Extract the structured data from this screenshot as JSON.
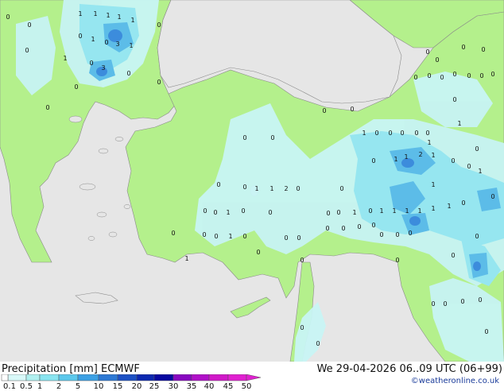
{
  "footer": {
    "title": "Precipitation [mm]  ECMWF",
    "datetime": "We 29-04-2026 06..09 UTC (06+99)",
    "credit": "©weatheronline.co.uk"
  },
  "legend": {
    "ticks": [
      "0.1",
      "0.5",
      "1",
      "2",
      "5",
      "10",
      "15",
      "20",
      "25",
      "30",
      "35",
      "40",
      "45",
      "50"
    ],
    "colors": [
      "#ffffff",
      "#d8f8f8",
      "#b0f0f0",
      "#88e4f0",
      "#5cc8ec",
      "#3ca0e4",
      "#2c78d4",
      "#1c50c4",
      "#0c28b0",
      "#0808a0",
      "#8808c0",
      "#b010c8",
      "#d018c8",
      "#e020d0"
    ]
  },
  "map_colors": {
    "sea": "#e6e6e6",
    "land": "#b4f08c",
    "precip_light": "#c8f4f4",
    "precip_moderate": "#96e6f0",
    "precip_heavy": "#5cbce8",
    "precip_intense": "#3c8cdc"
  },
  "values": [
    {
      "t": "1"
    },
    {
      "t": "1"
    },
    {
      "t": "1"
    },
    {
      "t": "1"
    },
    {
      "t": "1"
    },
    {
      "t": "0"
    },
    {
      "t": "0"
    },
    {
      "t": "0"
    },
    {
      "t": "0"
    },
    {
      "t": "1"
    },
    {
      "t": "0"
    },
    {
      "t": "3"
    },
    {
      "t": "1"
    },
    {
      "t": "0"
    },
    {
      "t": "1"
    },
    {
      "t": "0"
    },
    {
      "t": "3"
    },
    {
      "t": "0"
    },
    {
      "t": "0"
    },
    {
      "t": "0"
    },
    {
      "t": "0"
    },
    {
      "t": "0"
    },
    {
      "t": "0"
    },
    {
      "t": "0"
    },
    {
      "t": "0"
    },
    {
      "t": "0"
    },
    {
      "t": "0"
    },
    {
      "t": "0"
    },
    {
      "t": "0"
    },
    {
      "t": "0"
    },
    {
      "t": "0"
    },
    {
      "t": "0"
    },
    {
      "t": "0"
    },
    {
      "t": "1"
    },
    {
      "t": "0"
    },
    {
      "t": "0"
    },
    {
      "t": "0"
    },
    {
      "t": "0"
    },
    {
      "t": "1"
    },
    {
      "t": "0"
    },
    {
      "t": "0"
    },
    {
      "t": "0"
    },
    {
      "t": "0"
    },
    {
      "t": "0"
    },
    {
      "t": "1"
    },
    {
      "t": "0"
    },
    {
      "t": "0"
    },
    {
      "t": "1"
    },
    {
      "t": "1"
    },
    {
      "t": "2"
    },
    {
      "t": "1"
    },
    {
      "t": "0"
    },
    {
      "t": "0"
    },
    {
      "t": "0"
    },
    {
      "t": "1"
    },
    {
      "t": "1"
    },
    {
      "t": "2"
    },
    {
      "t": "0"
    },
    {
      "t": "0"
    },
    {
      "t": "0"
    },
    {
      "t": "0"
    },
    {
      "t": "1"
    },
    {
      "t": "0"
    },
    {
      "t": "1"
    },
    {
      "t": "1"
    },
    {
      "t": "1"
    },
    {
      "t": "1"
    },
    {
      "t": "1"
    },
    {
      "t": "1"
    },
    {
      "t": "0"
    },
    {
      "t": "0"
    },
    {
      "t": "0"
    },
    {
      "t": "0"
    },
    {
      "t": "1"
    },
    {
      "t": "0"
    },
    {
      "t": "0"
    },
    {
      "t": "0"
    },
    {
      "t": "0"
    },
    {
      "t": "0"
    },
    {
      "t": "0"
    },
    {
      "t": "0"
    },
    {
      "t": "0"
    },
    {
      "t": "0"
    },
    {
      "t": "1"
    },
    {
      "t": "0"
    },
    {
      "t": "0"
    },
    {
      "t": "0"
    },
    {
      "t": "1"
    },
    {
      "t": "1"
    },
    {
      "t": "0"
    },
    {
      "t": "0"
    },
    {
      "t": "1"
    },
    {
      "t": "0"
    },
    {
      "t": "0"
    },
    {
      "t": "0"
    },
    {
      "t": "0"
    },
    {
      "t": "0"
    },
    {
      "t": "0"
    },
    {
      "t": "0"
    },
    {
      "t": "0"
    },
    {
      "t": "0"
    },
    {
      "t": "0"
    },
    {
      "t": "0"
    },
    {
      "t": "0"
    },
    {
      "t": "0"
    },
    {
      "t": "0"
    },
    {
      "t": "0"
    }
  ]
}
